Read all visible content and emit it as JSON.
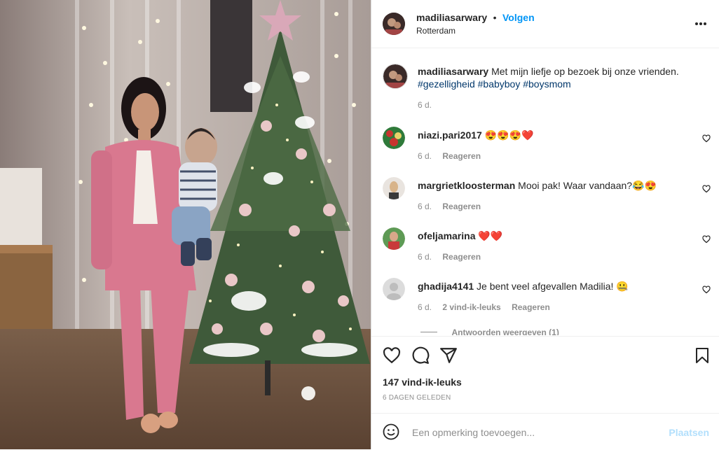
{
  "post": {
    "author": "madiliasarwary",
    "follow_label": "Volgen",
    "location": "Rotterdam",
    "caption_text": "Met mijn liefje op bezoek bij onze vrienden.",
    "hashtags": "#gezelligheid #babyboy #boysmom",
    "caption_age": "6 d."
  },
  "comments": [
    {
      "user": "niazi.pari2017",
      "text": "😍😍😍❤️",
      "age": "6 d.",
      "likes": "",
      "reply": "Reageren"
    },
    {
      "user": "margrietkloosterman",
      "text": "Mooi pak! Waar vandaan?😂😍",
      "age": "6 d.",
      "likes": "",
      "reply": "Reageren"
    },
    {
      "user": "ofeljamarina",
      "text": "❤️❤️",
      "age": "6 d.",
      "likes": "",
      "reply": "Reageren"
    },
    {
      "user": "ghadija4141",
      "text": "Je bent veel afgevallen Madilia! 🤐",
      "age": "6 d.",
      "likes": "2 vind-ik-leuks",
      "reply": "Reageren"
    }
  ],
  "view_replies": "Antwoorden weergeven (1)",
  "likes_count": "147 vind-ik-leuks",
  "timestamp": "6 DAGEN GELEDEN",
  "add_comment": {
    "placeholder": "Een opmerking toevoegen...",
    "post_label": "Plaatsen"
  },
  "icons": {
    "more": "more-icon",
    "heart": "heart-icon",
    "comment": "comment-icon",
    "share": "share-icon",
    "save": "bookmark-icon",
    "emoji": "emoji-icon"
  },
  "colors": {
    "follow": "#0095f6",
    "hashtag": "#00376b",
    "muted": "#8e8e8e",
    "post_disabled": "#b2dffc"
  }
}
